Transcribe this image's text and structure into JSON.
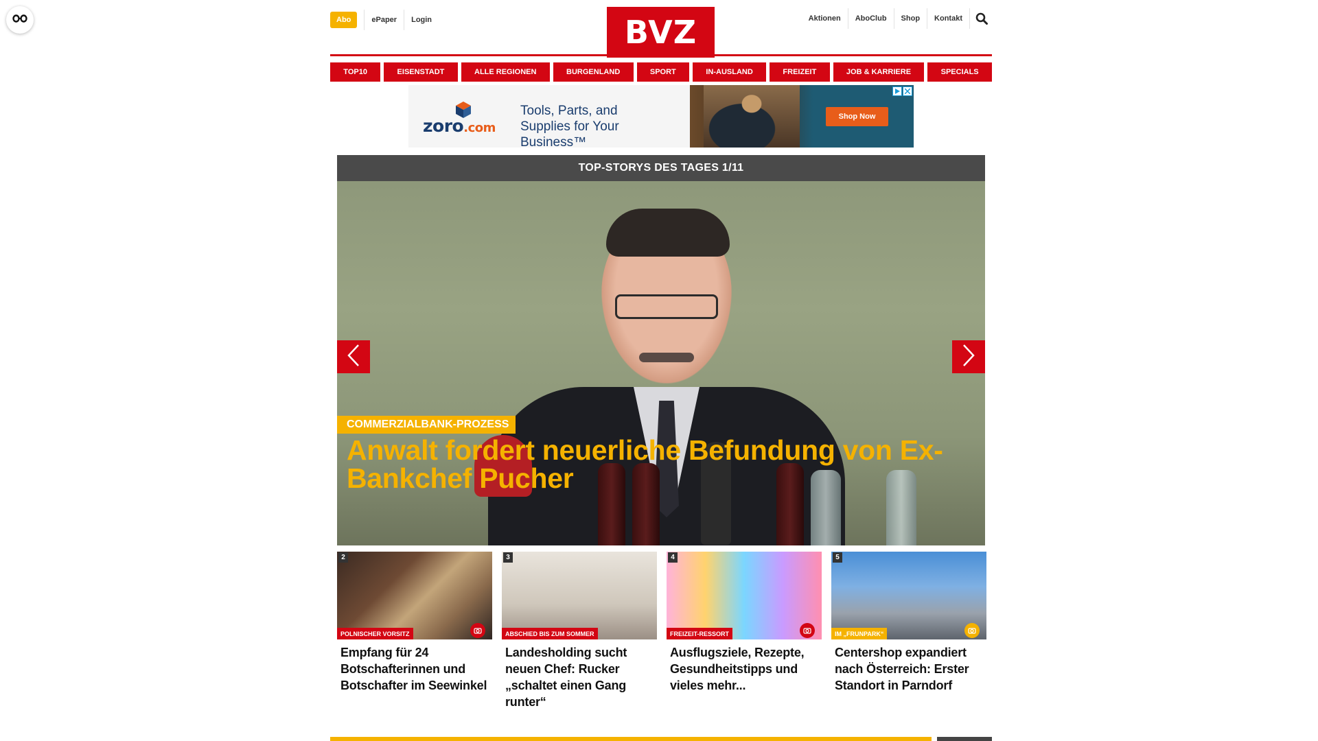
{
  "accessibility": {
    "icon": "glasses-icon"
  },
  "header": {
    "abo_label": "Abo",
    "left_links": [
      "ePaper",
      "Login"
    ],
    "logo_text": "BVZ",
    "right_links": [
      "Aktionen",
      "AboClub",
      "Shop",
      "Kontakt"
    ],
    "search_icon": "search-icon"
  },
  "nav": {
    "items": [
      "TOP10",
      "EISENSTADT",
      "ALLE REGIONEN",
      "BURGENLAND",
      "SPORT",
      "IN-AUSLAND",
      "FREIZEIT",
      "JOB & KARRIERE",
      "SPECIALS"
    ]
  },
  "ad": {
    "brand": "zoro",
    "brand_suffix": ".com",
    "tagline": "Tools, Parts, and Supplies for Your Business™",
    "cta": "Shop Now"
  },
  "slider": {
    "heading": "TOP-STORYS DES TAGES 1/11",
    "kicker": "COMMERZIALBANK-PROZESS",
    "title": "Anwalt fordert neuerliche Befundung von Ex-Bankchef Pucher",
    "prev_icon": "chevron-left-icon",
    "next_icon": "chevron-right-icon"
  },
  "teasers": [
    {
      "num": "2",
      "kicker": "POLNISCHER VORSITZ",
      "kicker_color": "#d30613",
      "title": "Empfang für 24 Botschafterinnen und Botschafter im Seewinkel",
      "camera": true
    },
    {
      "num": "3",
      "kicker": "ABSCHIED BIS ZUM SOMMER",
      "kicker_color": "#d30613",
      "title": "Landesholding sucht neuen Chef: Rucker „schaltet einen Gang runter“",
      "camera": false
    },
    {
      "num": "4",
      "kicker": "FREIZEIT-RESSORT",
      "kicker_color": "#d30613",
      "title": "Ausflugsziele, Rezepte, Gesundheitstipps und vieles mehr...",
      "camera": true
    },
    {
      "num": "5",
      "kicker": "IM „FRUNPARK“",
      "kicker_color": "#f5b200",
      "title": "Centershop expandiert nach Österreich: Erster Standort in Parndorf",
      "camera": true
    }
  ],
  "colors": {
    "brand_red": "#d30613",
    "accent_yellow": "#f5b200",
    "dark_gray": "#4a4a4a"
  }
}
